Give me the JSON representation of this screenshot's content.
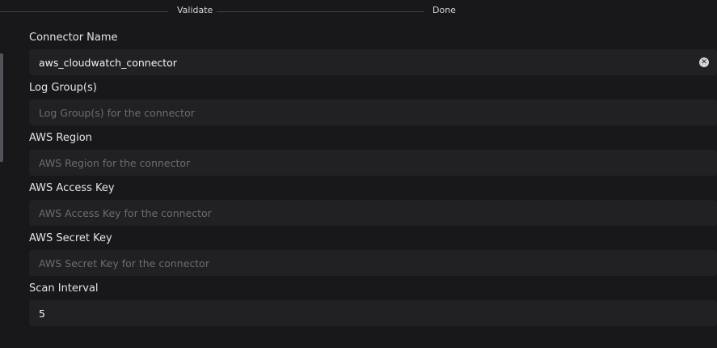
{
  "stepper": {
    "steps": [
      {
        "label": "Validate"
      },
      {
        "label": "Done"
      }
    ]
  },
  "form": {
    "fields": [
      {
        "label": "Connector Name",
        "value": "aws_cloudwatch_connector",
        "placeholder": ""
      },
      {
        "label": "Log Group(s)",
        "value": "",
        "placeholder": "Log Group(s) for the connector"
      },
      {
        "label": "AWS Region",
        "value": "",
        "placeholder": "AWS Region for the connector"
      },
      {
        "label": "AWS Access Key",
        "value": "",
        "placeholder": "AWS Access Key for the connector"
      },
      {
        "label": "AWS Secret Key",
        "value": "",
        "placeholder": "AWS Secret Key for the connector"
      },
      {
        "label": "Scan Interval",
        "value": "5",
        "placeholder": ""
      }
    ]
  },
  "icons": {
    "clear": "close-circle-icon"
  }
}
